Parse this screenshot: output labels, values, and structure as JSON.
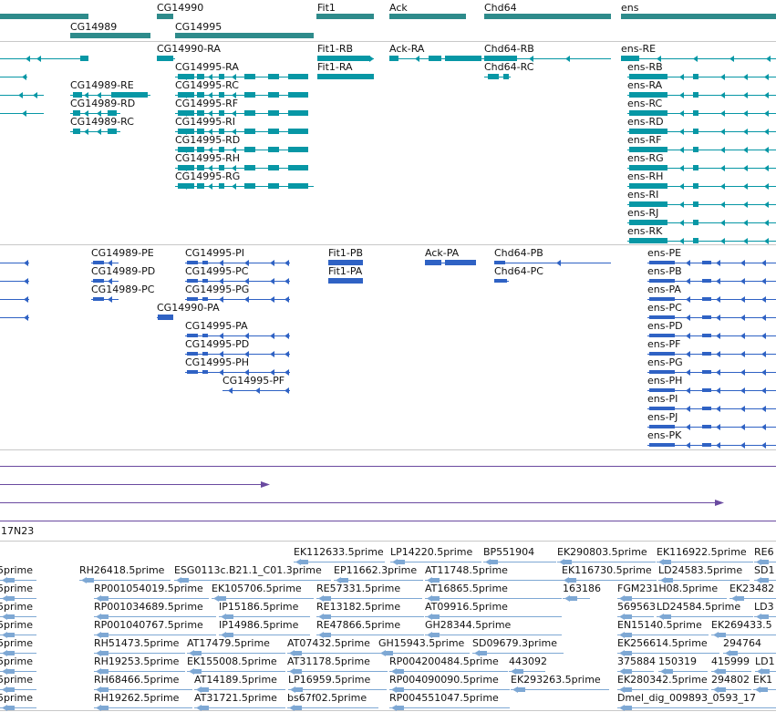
{
  "colors": {
    "gene": "#2e8b8b",
    "transcript": "#0797a5",
    "protein": "#2f62c4",
    "line": "#6a4aa0",
    "est": "#7ea8d4",
    "divider": "#c8c8c8"
  },
  "genes": {
    "items": [
      {
        "label": "CG14990"
      },
      {
        "label": "CG14989"
      },
      {
        "label": "CG14995"
      },
      {
        "label": "Fit1"
      },
      {
        "label": "Ack"
      },
      {
        "label": "Chd64"
      },
      {
        "label": "ens"
      }
    ]
  },
  "transcripts": {
    "items": [
      {
        "label": "CG14990-RA"
      },
      {
        "label": "CG14995-RA"
      },
      {
        "label": "CG14995-RC"
      },
      {
        "label": "CG14995-RF"
      },
      {
        "label": "CG14995-RI"
      },
      {
        "label": "CG14995-RD"
      },
      {
        "label": "CG14995-RH"
      },
      {
        "label": "CG14995-RG"
      },
      {
        "label": "CG14989-RE"
      },
      {
        "label": "CG14989-RD"
      },
      {
        "label": "CG14989-RC"
      },
      {
        "label": "Fit1-RB"
      },
      {
        "label": "Fit1-RA"
      },
      {
        "label": "Ack-RA"
      },
      {
        "label": "Chd64-RB"
      },
      {
        "label": "Chd64-RC"
      },
      {
        "label": "ens-RE"
      },
      {
        "label": "ens-RB"
      },
      {
        "label": "ens-RA"
      },
      {
        "label": "ens-RC"
      },
      {
        "label": "ens-RD"
      },
      {
        "label": "ens-RF"
      },
      {
        "label": "ens-RG"
      },
      {
        "label": "ens-RH"
      },
      {
        "label": "ens-RI"
      },
      {
        "label": "ens-RJ"
      },
      {
        "label": "ens-RK"
      }
    ]
  },
  "proteins": {
    "items": [
      {
        "label": "CG14989-PE"
      },
      {
        "label": "CG14989-PD"
      },
      {
        "label": "CG14989-PC"
      },
      {
        "label": "CG14990-PA"
      },
      {
        "label": "CG14995-PI"
      },
      {
        "label": "CG14995-PC"
      },
      {
        "label": "CG14995-PG"
      },
      {
        "label": "CG14995-PA"
      },
      {
        "label": "CG14995-PD"
      },
      {
        "label": "CG14995-PH"
      },
      {
        "label": "CG14995-PF"
      },
      {
        "label": "Fit1-PB"
      },
      {
        "label": "Fit1-PA"
      },
      {
        "label": "Ack-PA"
      },
      {
        "label": "Chd64-PB"
      },
      {
        "label": "Chd64-PC"
      },
      {
        "label": "ens-PE"
      },
      {
        "label": "ens-PB"
      },
      {
        "label": "ens-PA"
      },
      {
        "label": "ens-PC"
      },
      {
        "label": "ens-PD"
      },
      {
        "label": "ens-PF"
      },
      {
        "label": "ens-PG"
      },
      {
        "label": "ens-PH"
      },
      {
        "label": "ens-PI"
      },
      {
        "label": "ens-PJ"
      },
      {
        "label": "ens-PK"
      }
    ]
  },
  "clone": {
    "label": "17N23"
  },
  "ests": {
    "items": [
      {
        "label": "EK112633.5prime"
      },
      {
        "label": "LP14220.5prime"
      },
      {
        "label": "BP551904"
      },
      {
        "label": "EK290803.5prime"
      },
      {
        "label": "EK116922.5prime"
      },
      {
        "label": "RE6"
      },
      {
        "label": "5prime"
      },
      {
        "label": "RH26418.5prime"
      },
      {
        "label": "ESG0113c.B21.1_C01.3prime"
      },
      {
        "label": "EP11662.3prime"
      },
      {
        "label": "AT11748.5prime"
      },
      {
        "label": "EK116730.5prime"
      },
      {
        "label": "LD24583.5prime"
      },
      {
        "label": "SD1"
      },
      {
        "label": "5prime"
      },
      {
        "label": "RP001054019.5prime"
      },
      {
        "label": "EK105706.5prime"
      },
      {
        "label": "RE57331.5prime"
      },
      {
        "label": "AT16865.5prime"
      },
      {
        "label": "163186"
      },
      {
        "label": "FGM231H08.5prime"
      },
      {
        "label": "EK23482"
      },
      {
        "label": "5prime"
      },
      {
        "label": "RP001034689.5prime"
      },
      {
        "label": "IP15186.5prime"
      },
      {
        "label": "RE13182.5prime"
      },
      {
        "label": "AT09916.5prime"
      },
      {
        "label": "569563"
      },
      {
        "label": "LD24584.5prime"
      },
      {
        "label": "LD3"
      },
      {
        "label": "5prime"
      },
      {
        "label": "RP001040767.5prime"
      },
      {
        "label": "IP14986.5prime"
      },
      {
        "label": "RE47866.5prime"
      },
      {
        "label": "GH28344.5prime"
      },
      {
        "label": "EN15140.5prime"
      },
      {
        "label": "EK269433.5"
      },
      {
        "label": "5prime"
      },
      {
        "label": "RH51473.5prime"
      },
      {
        "label": "AT17479.5prime"
      },
      {
        "label": "AT07432.5prime"
      },
      {
        "label": "GH15943.5prime"
      },
      {
        "label": "SD09679.3prime"
      },
      {
        "label": "EK256614.5prime"
      },
      {
        "label": "294764"
      },
      {
        "label": "5prime"
      },
      {
        "label": "RH19253.5prime"
      },
      {
        "label": "EK155008.5prime"
      },
      {
        "label": "AT31178.5prime"
      },
      {
        "label": "RP004200484.5prime"
      },
      {
        "label": "443092"
      },
      {
        "label": "375884"
      },
      {
        "label": "150319"
      },
      {
        "label": "415999"
      },
      {
        "label": "LD1"
      },
      {
        "label": "5prime"
      },
      {
        "label": "RH68466.5prime"
      },
      {
        "label": "AT14189.5prime"
      },
      {
        "label": "LP16959.5prime"
      },
      {
        "label": "RP004090090.5prime"
      },
      {
        "label": "EK293263.5prime"
      },
      {
        "label": "EK280342.5prime"
      },
      {
        "label": "294802"
      },
      {
        "label": "EK1"
      },
      {
        "label": "5prime"
      },
      {
        "label": "RH19262.5prime"
      },
      {
        "label": "AT31721.5prime"
      },
      {
        "label": "bs67f02.5prime"
      },
      {
        "label": "RP004551047.5prime"
      },
      {
        "label": "Dmel_dig_009893_0593_17"
      }
    ]
  }
}
